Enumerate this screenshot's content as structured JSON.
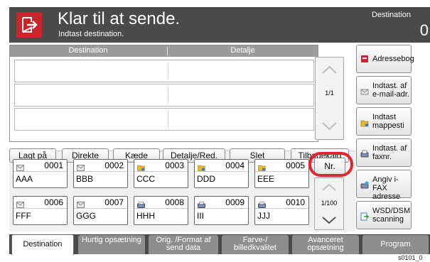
{
  "header": {
    "title": "Klar til at sende.",
    "subtitle": "Indtast destination.",
    "destination_label": "Destination",
    "destination_count": "0"
  },
  "table": {
    "col_destination": "Destination",
    "col_detail": "Detalje",
    "page": "1/1"
  },
  "right_buttons": [
    {
      "label": "Adressebog",
      "icon": "address-book-icon"
    },
    {
      "label": "Indtast. af e-mail-adr.",
      "icon": "email-icon"
    },
    {
      "label": "Indtast mappesti",
      "icon": "folder-icon"
    },
    {
      "label": "Indtast. af faxnr.",
      "icon": "fax-icon"
    },
    {
      "label": "Angiv i-FAX adresse",
      "icon": "ifax-icon"
    },
    {
      "label": "WSD/DSM scanning",
      "icon": "wsd-scan-icon"
    }
  ],
  "toolbar": [
    "Lagt på",
    "Direkte",
    "Kæde",
    "Detalje/Red.",
    "Slet",
    "Tilbagekald"
  ],
  "addresses": [
    {
      "num": "0001",
      "name": "AAA",
      "kind": "email"
    },
    {
      "num": "0002",
      "name": "BBB",
      "kind": "email"
    },
    {
      "num": "0003",
      "name": "CCC",
      "kind": "folder"
    },
    {
      "num": "0004",
      "name": "DDD",
      "kind": "folder"
    },
    {
      "num": "0005",
      "name": "EEE",
      "kind": "folder"
    },
    {
      "num": "0006",
      "name": "FFF",
      "kind": "email"
    },
    {
      "num": "0007",
      "name": "GGG",
      "kind": "email"
    },
    {
      "num": "0008",
      "name": "HHH",
      "kind": "fax"
    },
    {
      "num": "0009",
      "name": "III",
      "kind": "fax"
    },
    {
      "num": "0010",
      "name": "JJJ",
      "kind": "fax"
    }
  ],
  "address_controls": {
    "nr_label": "Nr.",
    "page": "1/100"
  },
  "tabs": [
    {
      "label": "Destination",
      "active": true
    },
    {
      "label": "Hurtig opsætning",
      "active": false
    },
    {
      "label": "Orig. /Format af send data",
      "active": false
    },
    {
      "label": "Farve-/ billedkvalitet",
      "active": false
    },
    {
      "label": "Avanceret opsætning",
      "active": false
    },
    {
      "label": "Program",
      "active": false
    }
  ],
  "footer_code": "s0101_0",
  "colors": {
    "header_bg": "#4a4a4a",
    "accent_red": "#c8252c",
    "highlight_ring": "#e0262f"
  }
}
